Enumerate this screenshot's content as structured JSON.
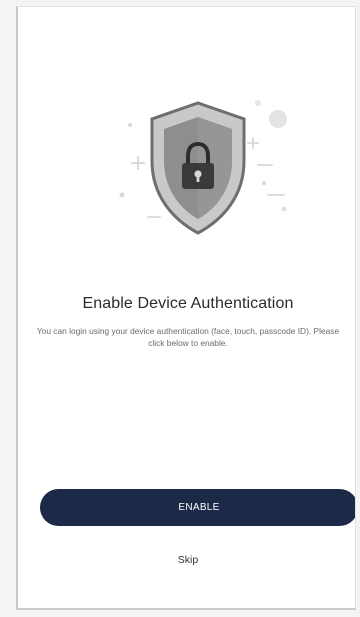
{
  "screen": {
    "title": "Enable Device Authentication",
    "description": "You can login using your device authentication (face, touch, passcode ID). Please click below to enable.",
    "enable_label": "ENABLE",
    "skip_label": "Skip"
  },
  "icons": {
    "illustration": "shield-lock-icon"
  },
  "colors": {
    "primary_button": "#1c2a47",
    "shield_fill": "#8a8a8a",
    "text_dark": "#2b2b2b"
  }
}
